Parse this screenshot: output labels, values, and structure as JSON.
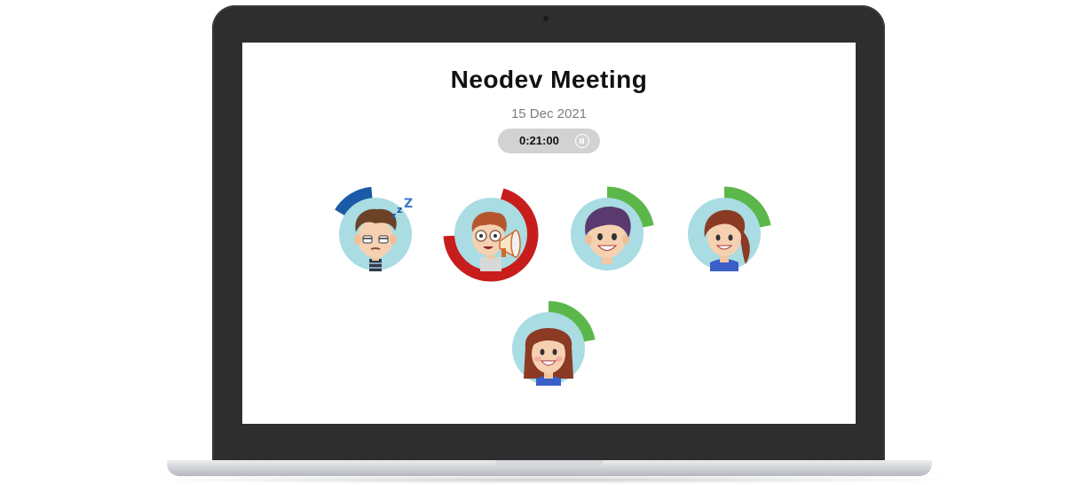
{
  "meeting": {
    "title": "Neodev  Meeting",
    "date": "15 Dec 2021",
    "timer": "0:21:00"
  },
  "colors": {
    "sleepy_ring": "#1b5aa6",
    "speaking_ring": "#c81d1d",
    "active_ring": "#5bb749",
    "avatar_bg": "#a9dce3"
  },
  "participants": [
    {
      "name": "sleepy-guy",
      "status": "asleep",
      "ring_color": "#1b5aa6",
      "ring_fraction": 0.15
    },
    {
      "name": "speaker-guy",
      "status": "speaking",
      "ring_color": "#c81d1d",
      "ring_fraction": 0.7
    },
    {
      "name": "dark-hair-boy",
      "status": "idle",
      "ring_color": "#5bb749",
      "ring_fraction": 0.22
    },
    {
      "name": "ponytail-girl",
      "status": "idle",
      "ring_color": "#5bb749",
      "ring_fraction": 0.22
    },
    {
      "name": "long-hair-girl",
      "status": "idle",
      "ring_color": "#5bb749",
      "ring_fraction": 0.22
    }
  ],
  "icons": {
    "pause": "pause-icon",
    "megaphone": "megaphone-icon",
    "sleep": "zzz-icon"
  }
}
